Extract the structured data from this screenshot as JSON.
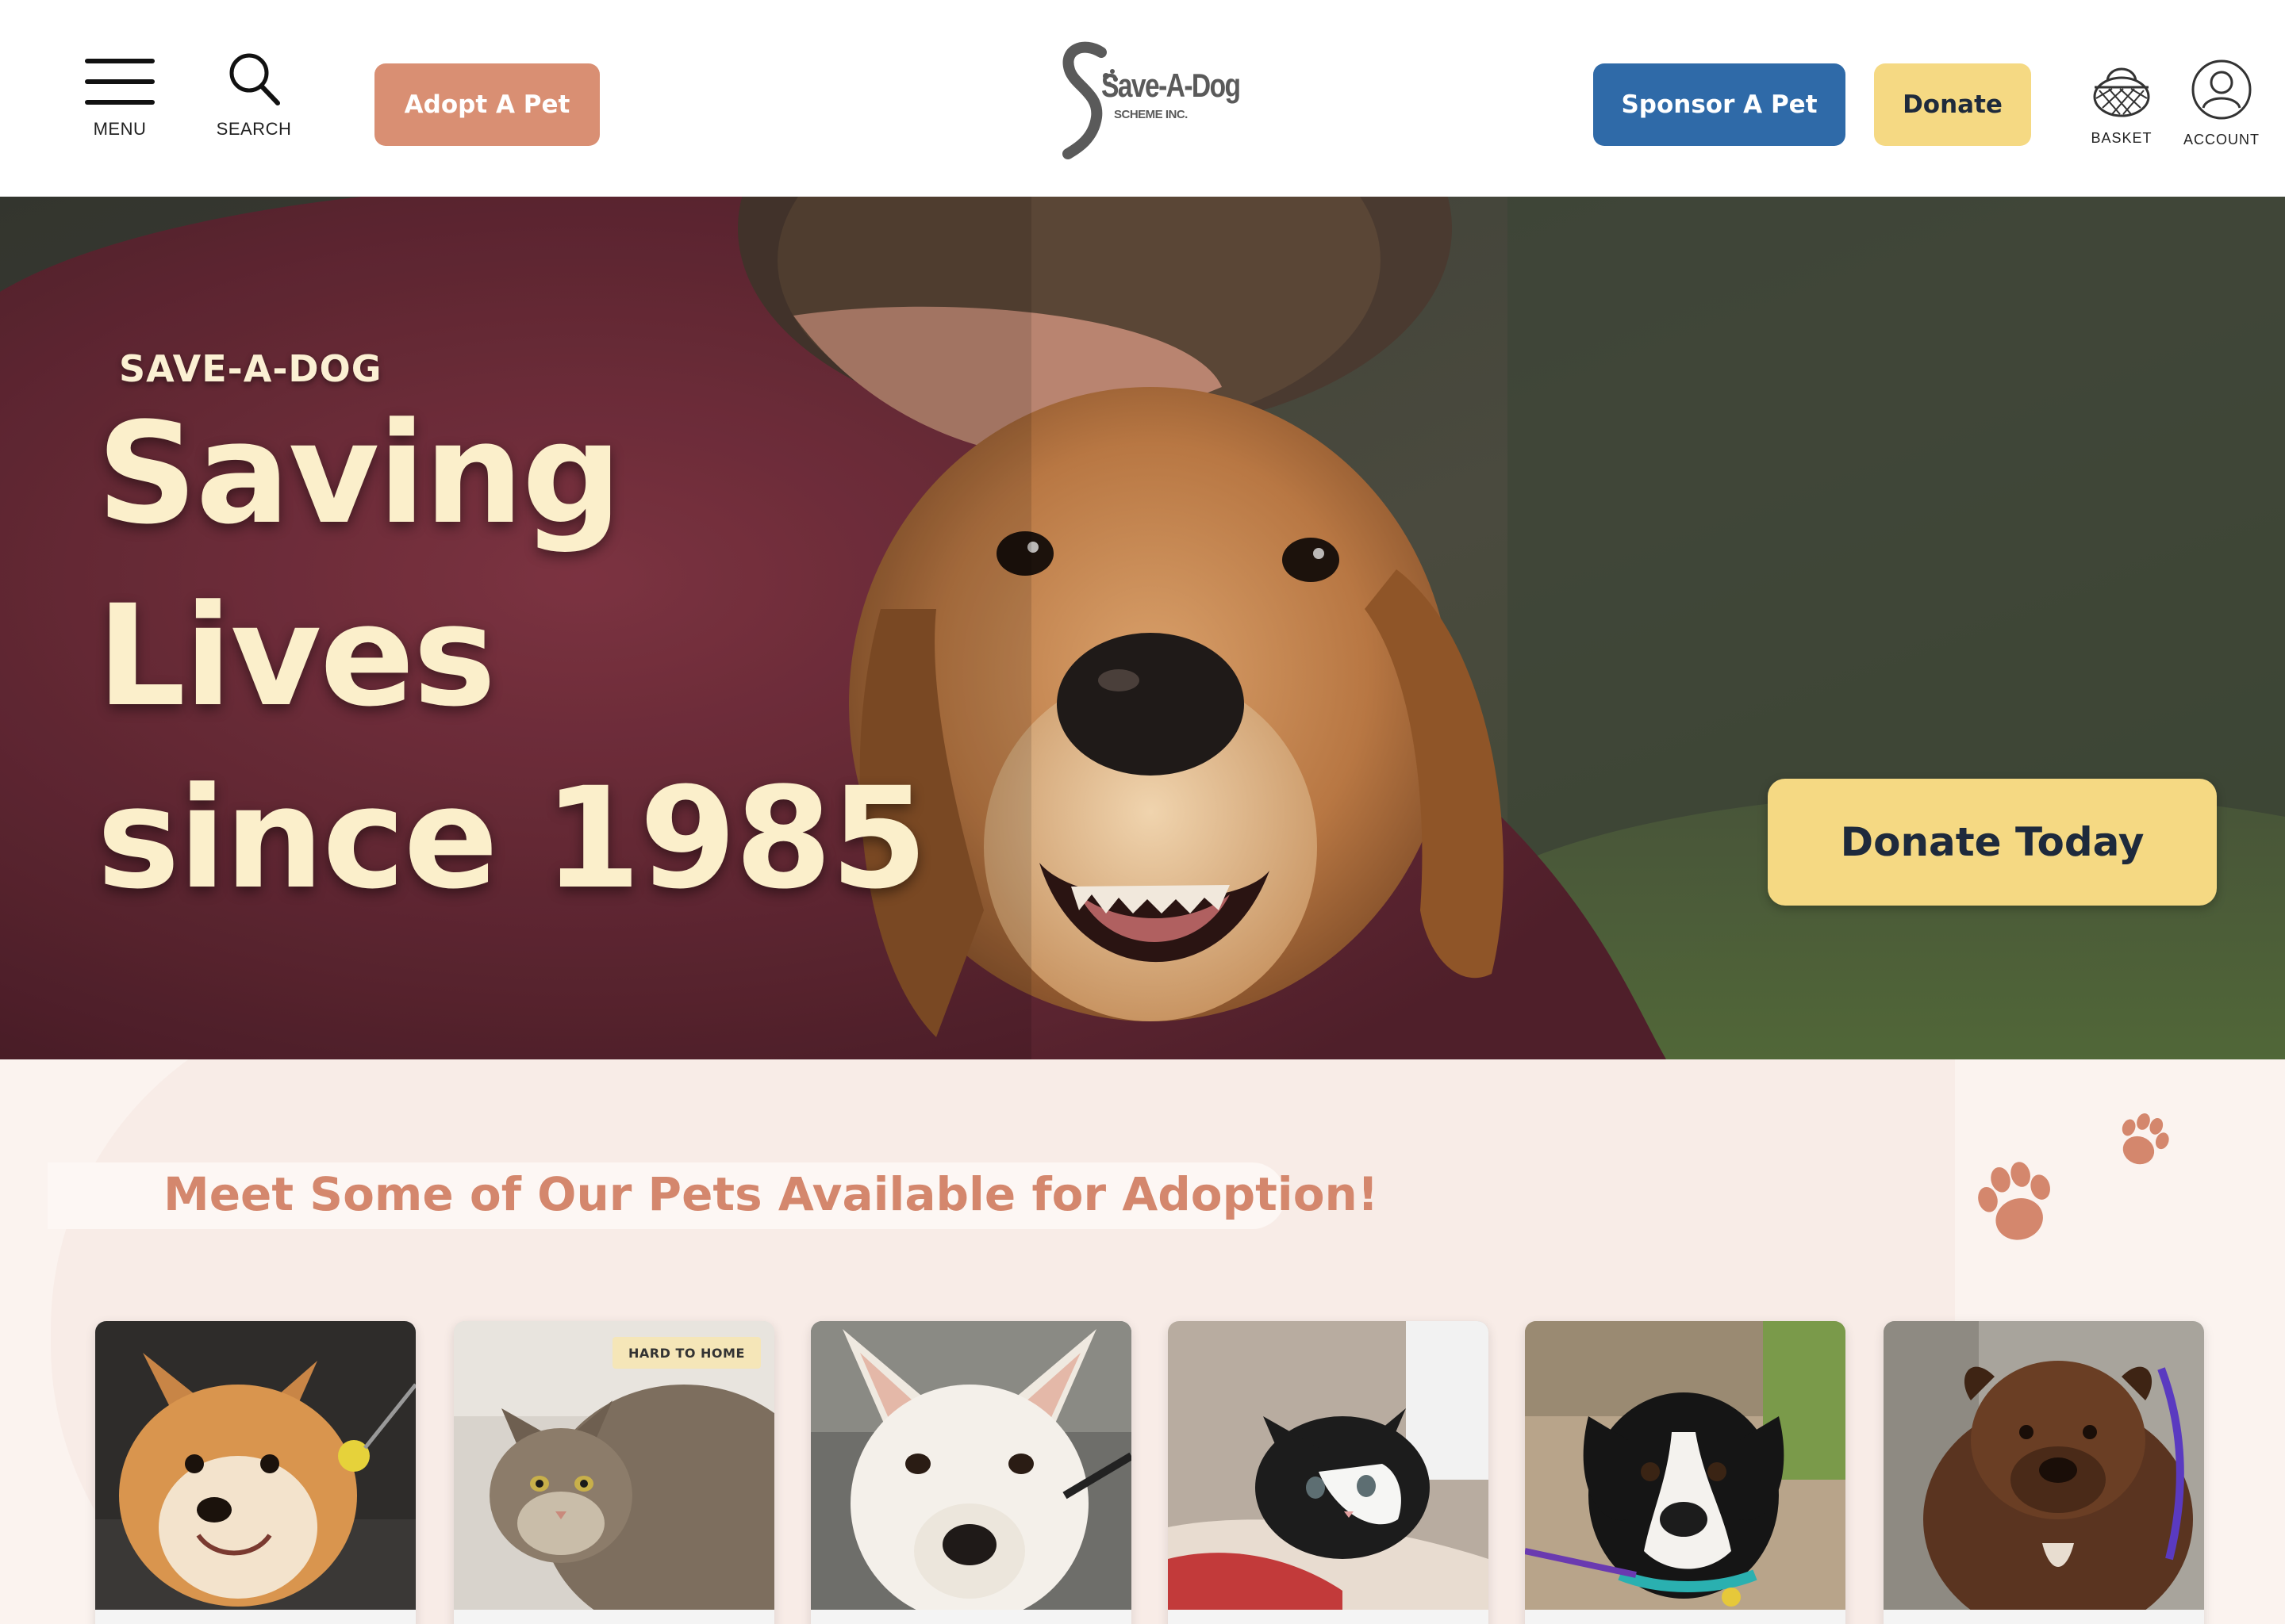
{
  "header": {
    "menu_label": "MENU",
    "search_label": "SEARCH",
    "adopt_label": "Adopt A Pet",
    "logo_main": "Save-A-Dog",
    "logo_sub": "SCHEME INC.",
    "sponsor_label": "Sponsor A Pet",
    "donate_label": "Donate",
    "basket_label": "BASKET",
    "account_label": "ACCOUNT"
  },
  "hero": {
    "eyebrow": "SAVE-A-DOG",
    "headline_line1": "Saving",
    "headline_line2": "Lives",
    "headline_line3": "since 1985",
    "cta_label": "Donate Today"
  },
  "adoption": {
    "title": "Meet Some of Our Pets Available for Adoption!",
    "pets": [
      {
        "image": "corgi-mix-dog-photo"
      },
      {
        "image": "grey-tabby-cat-photo",
        "badge": "HARD TO HOME"
      },
      {
        "image": "white-shepherd-dog-photo"
      },
      {
        "image": "black-white-kitten-photo"
      },
      {
        "image": "black-white-pup-photo"
      },
      {
        "image": "brindle-staffy-dog-photo"
      }
    ]
  },
  "colors": {
    "adopt": "#d98f73",
    "sponsor": "#2f6aa8",
    "donate": "#f5d983",
    "headline": "#fbefcb",
    "section_title": "#d4876d"
  }
}
